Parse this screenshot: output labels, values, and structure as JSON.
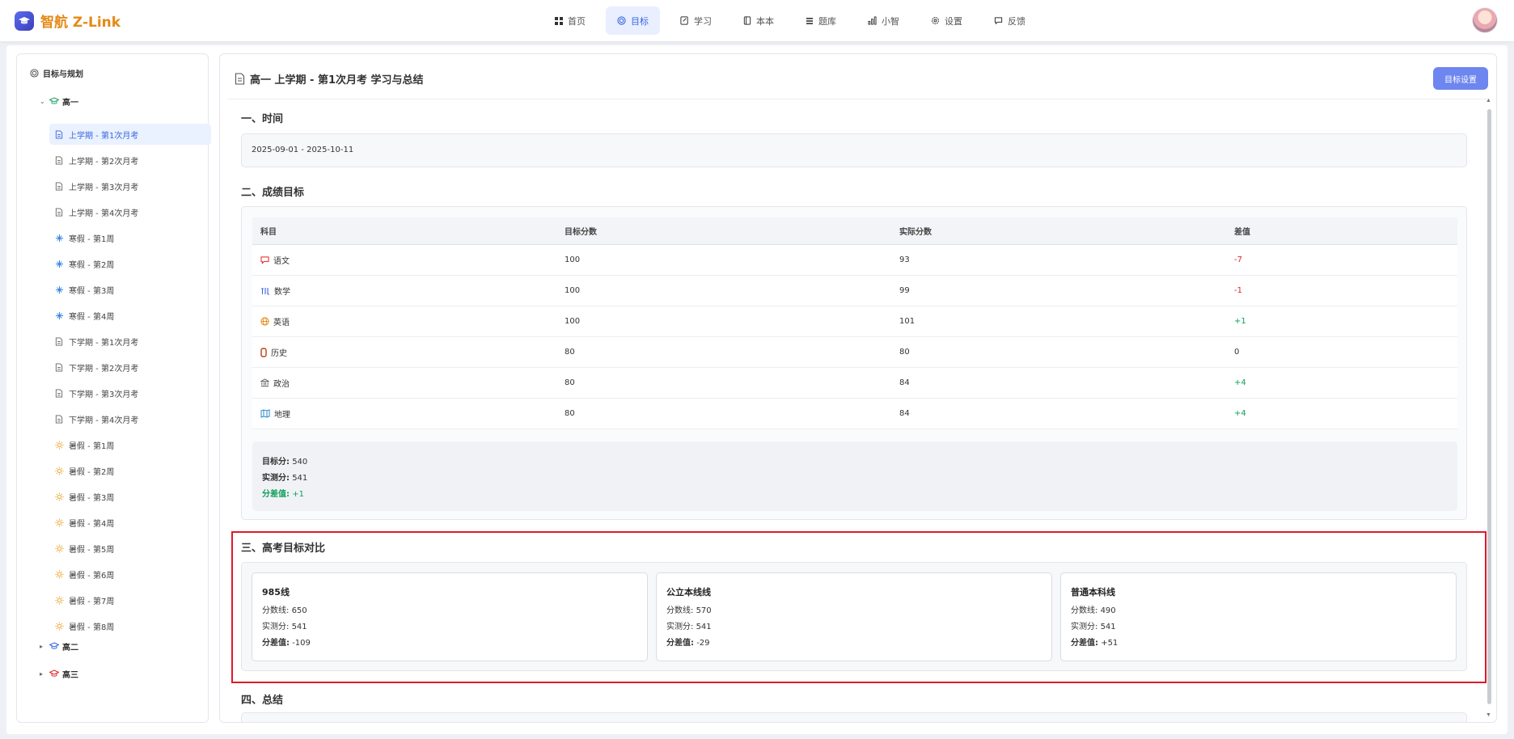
{
  "app": {
    "title": "智航 Z-Link"
  },
  "nav": [
    {
      "label": "首页",
      "icon": "grid-icon",
      "active": false
    },
    {
      "label": "目标",
      "icon": "target-icon",
      "active": true
    },
    {
      "label": "学习",
      "icon": "edit-doc-icon",
      "active": false
    },
    {
      "label": "本本",
      "icon": "notebook-icon",
      "active": false
    },
    {
      "label": "题库",
      "icon": "list-icon",
      "active": false
    },
    {
      "label": "小智",
      "icon": "bar-chart-icon",
      "active": false
    },
    {
      "label": "设置",
      "icon": "gear-icon",
      "active": false
    },
    {
      "label": "反馈",
      "icon": "message-icon",
      "active": false
    }
  ],
  "sidebar": {
    "title": "目标与规划",
    "groups": [
      {
        "label": "高一",
        "expanded": true,
        "color": "#22a06b"
      },
      {
        "label": "高二",
        "expanded": false,
        "color": "#3a66e0"
      },
      {
        "label": "高三",
        "expanded": false,
        "color": "#e02424"
      }
    ],
    "items": [
      {
        "label": "上学期 - 第1次月考",
        "icon": "document-icon",
        "active": true
      },
      {
        "label": "上学期 - 第2次月考",
        "icon": "document-icon"
      },
      {
        "label": "上学期 - 第3次月考",
        "icon": "document-icon"
      },
      {
        "label": "上学期 - 第4次月考",
        "icon": "document-icon"
      },
      {
        "label": "寒假 - 第1周",
        "icon": "snowflake-icon"
      },
      {
        "label": "寒假 - 第2周",
        "icon": "snowflake-icon"
      },
      {
        "label": "寒假 - 第3周",
        "icon": "snowflake-icon"
      },
      {
        "label": "寒假 - 第4周",
        "icon": "snowflake-icon"
      },
      {
        "label": "下学期 - 第1次月考",
        "icon": "document-icon"
      },
      {
        "label": "下学期 - 第2次月考",
        "icon": "document-icon"
      },
      {
        "label": "下学期 - 第3次月考",
        "icon": "document-icon"
      },
      {
        "label": "下学期 - 第4次月考",
        "icon": "document-icon"
      },
      {
        "label": "暑假 - 第1周",
        "icon": "sun-icon"
      },
      {
        "label": "暑假 - 第2周",
        "icon": "sun-icon"
      },
      {
        "label": "暑假 - 第3周",
        "icon": "sun-icon"
      },
      {
        "label": "暑假 - 第4周",
        "icon": "sun-icon"
      },
      {
        "label": "暑假 - 第5周",
        "icon": "sun-icon"
      },
      {
        "label": "暑假 - 第6周",
        "icon": "sun-icon"
      },
      {
        "label": "暑假 - 第7周",
        "icon": "sun-icon"
      },
      {
        "label": "暑假 - 第8周",
        "icon": "sun-icon"
      }
    ]
  },
  "content": {
    "title": "高一 上学期 - 第1次月考 学习与总结",
    "goal_button": "目标设置",
    "sections": {
      "time": "一、时间",
      "score": "二、成绩目标",
      "compare": "三、高考目标对比",
      "summary": "四、总结"
    },
    "time_range": "2025-09-01 - 2025-10-11",
    "table": {
      "headers": [
        "科目",
        "目标分数",
        "实际分数",
        "差值"
      ],
      "rows": [
        {
          "subject": "语文",
          "icon": "chat-icon",
          "target": "100",
          "actual": "93",
          "diff": "-7",
          "tone": "neg"
        },
        {
          "subject": "数学",
          "icon": "formula-icon",
          "target": "100",
          "actual": "99",
          "diff": "-1",
          "tone": "neg"
        },
        {
          "subject": "英语",
          "icon": "globe-icon",
          "target": "100",
          "actual": "101",
          "diff": "+1",
          "tone": "pos"
        },
        {
          "subject": "历史",
          "icon": "scroll-icon",
          "target": "80",
          "actual": "80",
          "diff": "0",
          "tone": "zero"
        },
        {
          "subject": "政治",
          "icon": "landmark-icon",
          "target": "80",
          "actual": "84",
          "diff": "+4",
          "tone": "pos"
        },
        {
          "subject": "地理",
          "icon": "map-icon",
          "target": "80",
          "actual": "84",
          "diff": "+4",
          "tone": "pos"
        }
      ]
    },
    "totals": {
      "target_label": "目标分:",
      "target_value": "540",
      "actual_label": "实测分:",
      "actual_value": "541",
      "diff_label": "分差值:",
      "diff_value": "+1"
    },
    "compare_cards": [
      {
        "title": "985线",
        "line_label": "分数线:",
        "line_value": "650",
        "actual_label": "实测分:",
        "actual_value": "541",
        "diff_label": "分差值:",
        "diff_value": "-109",
        "tone": "neg"
      },
      {
        "title": "公立本线线",
        "line_label": "分数线:",
        "line_value": "570",
        "actual_label": "实测分:",
        "actual_value": "541",
        "diff_label": "分差值:",
        "diff_value": "-29",
        "tone": "neg"
      },
      {
        "title": "普通本科线",
        "line_label": "分数线:",
        "line_value": "490",
        "actual_label": "实测分:",
        "actual_value": "541",
        "diff_label": "分差值:",
        "diff_value": "+51",
        "tone": "pos"
      }
    ]
  },
  "colors": {
    "accent": "#3a66e0",
    "brand": "#e48a17",
    "negative": "#e02424",
    "positive": "#0f9d58",
    "highlight": "#e0182a"
  }
}
